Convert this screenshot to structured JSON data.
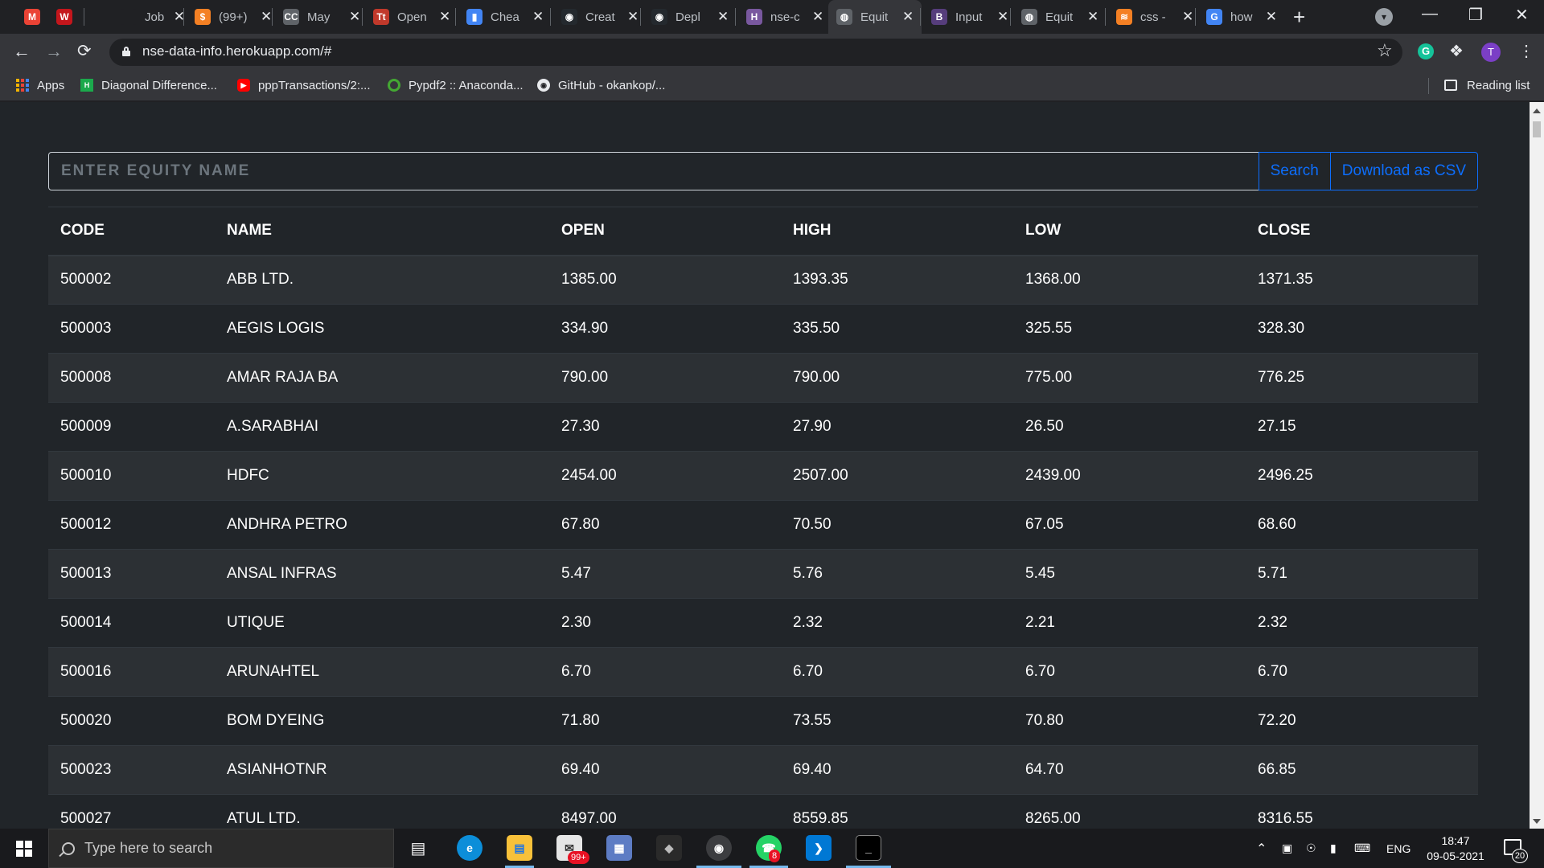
{
  "browser": {
    "tabs": [
      {
        "title": "",
        "favicon": "M",
        "color": "#ea4335"
      },
      {
        "title": "",
        "favicon": "W",
        "color": "#c4161c"
      },
      {
        "title": "Job A",
        "favicon": "",
        "color": "#202124"
      },
      {
        "title": "(99+)",
        "favicon": "$",
        "color": "#f48024"
      },
      {
        "title": "May",
        "favicon": "CC",
        "color": "#5f6368"
      },
      {
        "title": "Open",
        "favicon": "Tt",
        "color": "#c0392b"
      },
      {
        "title": "Chea",
        "favicon": "▮",
        "color": "#4285f4"
      },
      {
        "title": "Creat",
        "favicon": "◉",
        "color": "#24292e"
      },
      {
        "title": "Depl",
        "favicon": "◉",
        "color": "#24292e"
      },
      {
        "title": "nse-c",
        "favicon": "H",
        "color": "#79589f"
      },
      {
        "title": "Equit",
        "favicon": "◍",
        "color": "#5f6368"
      },
      {
        "title": "Input",
        "favicon": "B",
        "color": "#563d7c"
      },
      {
        "title": "Equit",
        "favicon": "◍",
        "color": "#5f6368"
      },
      {
        "title": "css -",
        "favicon": "≋",
        "color": "#f48024"
      },
      {
        "title": "how",
        "favicon": "G",
        "color": "#4285f4"
      }
    ],
    "active_tab_index": 10,
    "url": "nse-data-info.herokuapp.com/#",
    "profile_initial": "T",
    "extension_initial": "G",
    "bookmarks": [
      {
        "label": "Apps",
        "icon": "apps-grid-icon"
      },
      {
        "label": "Diagonal Difference...",
        "icon": "hackerrank-icon"
      },
      {
        "label": "pppTransactions/2:...",
        "icon": "youtube-icon"
      },
      {
        "label": "Pypdf2 :: Anaconda...",
        "icon": "anaconda-icon"
      },
      {
        "label": "GitHub - okankop/...",
        "icon": "github-icon"
      }
    ],
    "reading_list": "Reading list"
  },
  "page": {
    "search_placeholder": "ENTER EQUITY NAME",
    "search_value": "",
    "search_button": "Search",
    "download_button": "Download as CSV",
    "table": {
      "headers": [
        "CODE",
        "NAME",
        "OPEN",
        "HIGH",
        "LOW",
        "CLOSE"
      ],
      "rows": [
        [
          "500002",
          "ABB LTD.",
          "1385.00",
          "1393.35",
          "1368.00",
          "1371.35"
        ],
        [
          "500003",
          "AEGIS LOGIS",
          "334.90",
          "335.50",
          "325.55",
          "328.30"
        ],
        [
          "500008",
          "AMAR RAJA BA",
          "790.00",
          "790.00",
          "775.00",
          "776.25"
        ],
        [
          "500009",
          "A.SARABHAI",
          "27.30",
          "27.90",
          "26.50",
          "27.15"
        ],
        [
          "500010",
          "HDFC",
          "2454.00",
          "2507.00",
          "2439.00",
          "2496.25"
        ],
        [
          "500012",
          "ANDHRA PETRO",
          "67.80",
          "70.50",
          "67.05",
          "68.60"
        ],
        [
          "500013",
          "ANSAL INFRAS",
          "5.47",
          "5.76",
          "5.45",
          "5.71"
        ],
        [
          "500014",
          "UTIQUE",
          "2.30",
          "2.32",
          "2.21",
          "2.32"
        ],
        [
          "500016",
          "ARUNAHTEL",
          "6.70",
          "6.70",
          "6.70",
          "6.70"
        ],
        [
          "500020",
          "BOM DYEING",
          "71.80",
          "73.55",
          "70.80",
          "72.20"
        ],
        [
          "500023",
          "ASIANHOTNR",
          "69.40",
          "69.40",
          "64.70",
          "66.85"
        ],
        [
          "500027",
          "ATUL LTD.",
          "8497.00",
          "8559.85",
          "8265.00",
          "8316.55"
        ]
      ]
    }
  },
  "taskbar": {
    "search_placeholder": "Type here to search",
    "mail_badge": "99+",
    "whatsapp_badge": "8",
    "language": "ENG",
    "time": "18:47",
    "date": "09-05-2021",
    "notification_count": "20"
  }
}
